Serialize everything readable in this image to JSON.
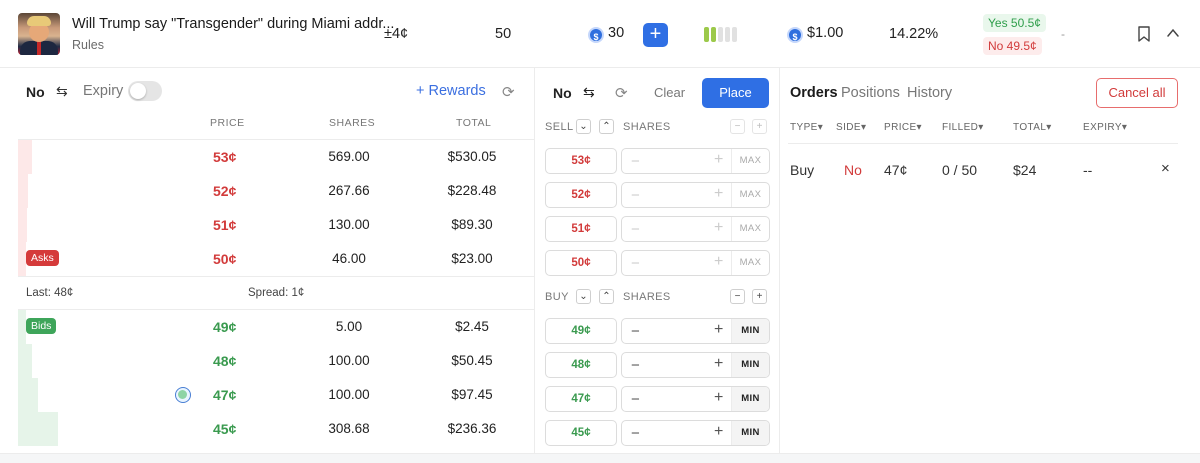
{
  "market": {
    "title": "Will Trump say \"Transgender\" during Miami addr...",
    "rules_label": "Rules",
    "change": "±4¢",
    "quantity": "50",
    "coins": "30",
    "coin_symbol": "$",
    "plus_label": "+",
    "price": "$1.00",
    "percent": "14.22%",
    "yes_price": "Yes 50.5¢",
    "no_price": "No 49.5¢",
    "dash": "-",
    "bars_filled": 2,
    "bars_total": 5,
    "icons": [
      "portrait-icon",
      "coin-icon",
      "bookmark-icon",
      "chevron-up-icon"
    ]
  },
  "orderbook": {
    "side": "No",
    "swap_icon": "⇆",
    "expiry_label": "Expiry",
    "expiry_enabled": false,
    "rewards_label": "+ Rewards",
    "refresh_icon": "⟳",
    "columns": [
      "PRICE",
      "SHARES",
      "TOTAL"
    ],
    "asks_badge": "Asks",
    "bids_badge": "Bids",
    "asks": [
      {
        "price": "53¢",
        "shares": "569.00",
        "total": "$530.05"
      },
      {
        "price": "52¢",
        "shares": "267.66",
        "total": "$228.48"
      },
      {
        "price": "51¢",
        "shares": "130.00",
        "total": "$89.30"
      },
      {
        "price": "50¢",
        "shares": "46.00",
        "total": "$23.00"
      }
    ],
    "last": "Last: 48¢",
    "spread": "Spread: 1¢",
    "bids": [
      {
        "price": "49¢",
        "shares": "5.00",
        "total": "$2.45"
      },
      {
        "price": "48¢",
        "shares": "100.00",
        "total": "$50.45"
      },
      {
        "price": "47¢",
        "shares": "100.00",
        "total": "$97.45"
      },
      {
        "price": "45¢",
        "shares": "308.68",
        "total": "$236.36"
      }
    ],
    "colors": {
      "ask": "#d23b3b",
      "bid": "#3a9a4f",
      "ask_bar": "#fde8e8",
      "bid_bar": "#e6f4e9"
    }
  },
  "entry": {
    "side": "No",
    "clear_label": "Clear",
    "place_label": "Place",
    "sell_label": "SELL",
    "buy_label": "BUY",
    "shares_label": "SHARES",
    "max_label": "MAX",
    "min_label": "MIN",
    "minus": "−",
    "plus": "+",
    "chevron_down": "⌄",
    "chevron_up": "⌃",
    "sell_prices": [
      "53¢",
      "52¢",
      "51¢",
      "50¢"
    ],
    "buy_prices": [
      "49¢",
      "48¢",
      "47¢",
      "45¢"
    ]
  },
  "orders": {
    "tabs": [
      "Orders",
      "Positions",
      "History"
    ],
    "cancel_all_label": "Cancel all",
    "columns": [
      "TYPE▾",
      "SIDE▾",
      "PRICE▾",
      "FILLED▾",
      "TOTAL▾",
      "EXPIRY▾"
    ],
    "rows": [
      {
        "type": "Buy",
        "side": "No",
        "price": "47¢",
        "filled": "0 / 50",
        "total": "$24",
        "expiry": "--",
        "close": "×"
      }
    ]
  }
}
